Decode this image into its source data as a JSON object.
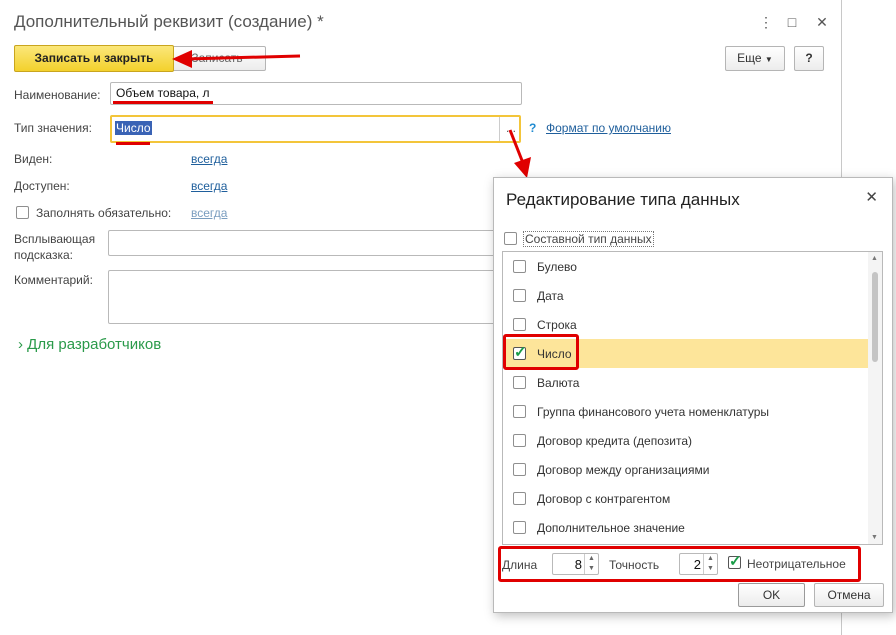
{
  "window": {
    "title": "Дополнительный реквизит (создание) *",
    "controls": {
      "menu": "⋮",
      "maximize": "□",
      "close": "✕"
    }
  },
  "toolbar": {
    "save_close": "Записать и закрыть",
    "save": "Записать",
    "more": "Еще",
    "help": "?"
  },
  "form": {
    "name_label": "Наименование:",
    "name_value": "Объем товара, л",
    "type_label": "Тип значения:",
    "type_value": "Число",
    "type_help": "?",
    "format_link": "Формат по умолчанию",
    "visible_label": "Виден:",
    "visible_value": "всегда",
    "available_label": "Доступен:",
    "available_value": "всегда",
    "required_label": "Заполнять обязательно:",
    "required_value": "всегда",
    "tooltip_label": "Всплывающая подсказка:",
    "comment_label": "Комментарий:",
    "dev_section": "Для разработчиков"
  },
  "dialog": {
    "title": "Редактирование типа данных",
    "composite_label": "Составной тип данных",
    "types": [
      {
        "label": "Булево",
        "checked": false
      },
      {
        "label": "Дата",
        "checked": false
      },
      {
        "label": "Строка",
        "checked": false
      },
      {
        "label": "Число",
        "checked": true
      },
      {
        "label": "Валюта",
        "checked": false
      },
      {
        "label": "Группа финансового учета номенклатуры",
        "checked": false
      },
      {
        "label": "Договор кредита (депозита)",
        "checked": false
      },
      {
        "label": "Договор между организациями",
        "checked": false
      },
      {
        "label": "Договор с контрагентом",
        "checked": false
      },
      {
        "label": "Дополнительное значение",
        "checked": false
      }
    ],
    "length_label": "Длина",
    "length_value": "8",
    "precision_label": "Точность",
    "precision_value": "2",
    "nonnegative_label": "Неотрицательное",
    "ok": "OK",
    "cancel": "Отмена"
  },
  "colors": {
    "accent": "#f3d12c",
    "annotation": "#e00000",
    "link": "#1f5f9c",
    "selected_row": "#fde59a"
  }
}
